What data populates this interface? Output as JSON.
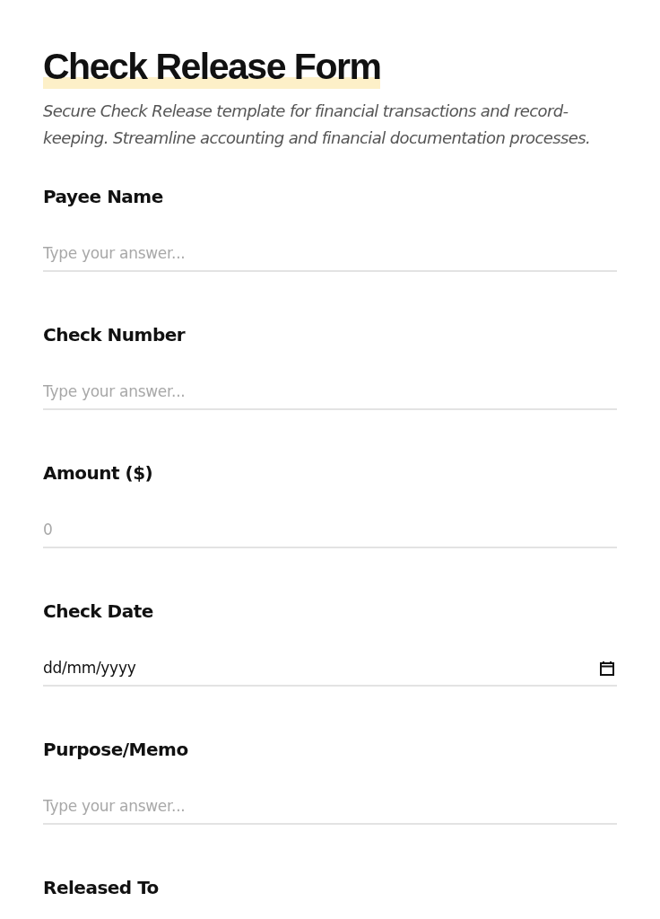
{
  "title": "Check Release Form",
  "description": "Secure Check Release template for financial transactions and record-keeping. Streamline accounting and financial documentation processes.",
  "fields": [
    {
      "kind": "text",
      "label": "Payee Name",
      "placeholder": "Type your answer..."
    },
    {
      "kind": "text",
      "label": "Check Number",
      "placeholder": "Type your answer..."
    },
    {
      "kind": "number",
      "label": "Amount ($)",
      "placeholder": "0"
    },
    {
      "kind": "date",
      "label": "Check Date",
      "placeholder": "dd/mm/yyyy"
    },
    {
      "kind": "text",
      "label": "Purpose/Memo",
      "placeholder": "Type your answer..."
    },
    {
      "kind": "heading",
      "label": "Released To"
    }
  ]
}
